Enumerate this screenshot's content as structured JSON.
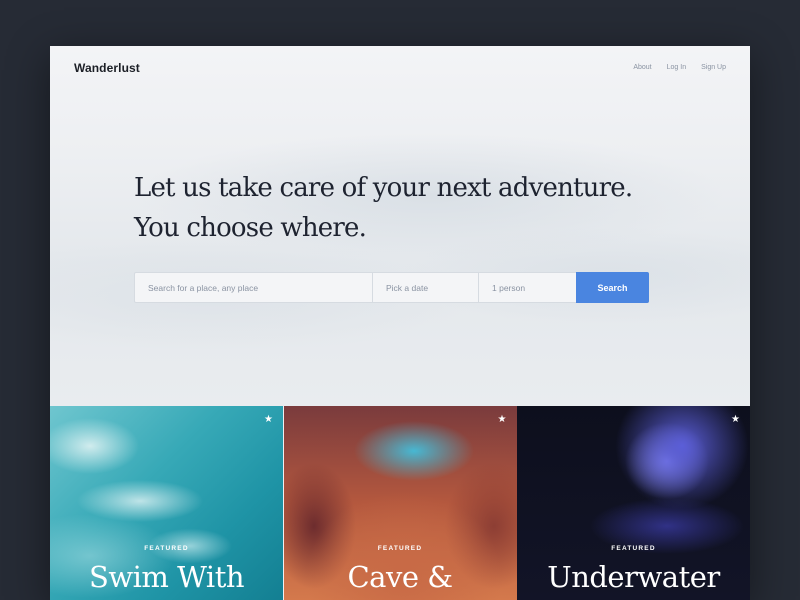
{
  "header": {
    "brand": "Wanderlust",
    "nav": [
      "About",
      "Log In",
      "Sign Up"
    ]
  },
  "hero": {
    "headline_line1": "Let us take care of your next adventure.",
    "headline_line2": "You choose where."
  },
  "search": {
    "place_placeholder": "Search for a place, any place",
    "date_placeholder": "Pick a date",
    "guests_value": "1 person",
    "button_label": "Search"
  },
  "cards": [
    {
      "badge": "FEATURED",
      "title": "Swim With",
      "icon": "star-icon"
    },
    {
      "badge": "FEATURED",
      "title": "Cave &",
      "icon": "star-icon"
    },
    {
      "badge": "FEATURED",
      "title": "Underwater",
      "icon": "star-icon"
    }
  ],
  "colors": {
    "background": "#262b35",
    "accent": "#4a85e0",
    "text": "#1e2330"
  }
}
